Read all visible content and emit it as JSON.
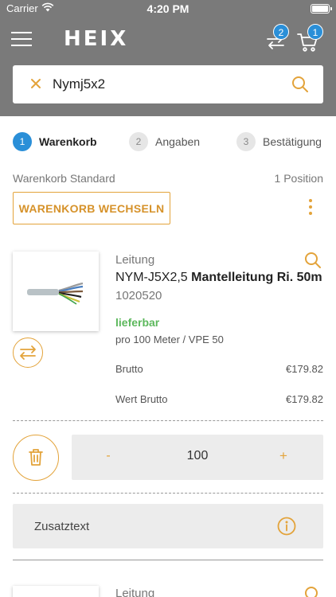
{
  "status_bar": {
    "carrier": "Carrier",
    "time": "4:20 PM"
  },
  "header": {
    "logo": "HEIX",
    "compare_badge": "2",
    "cart_badge": "1"
  },
  "search": {
    "value": "Nymj5x2"
  },
  "steps": [
    {
      "number": "1",
      "label": "Warenkorb",
      "active": true
    },
    {
      "number": "2",
      "label": "Angaben",
      "active": false
    },
    {
      "number": "3",
      "label": "Bestätigung",
      "active": false
    }
  ],
  "cart": {
    "title": "Warenkorb Standard",
    "position_count": "1 Position",
    "switch_button": "WARENKORB WECHSELN"
  },
  "product": {
    "category": "Leitung",
    "name_prefix": "NYM-J5X2,5 ",
    "name_bold": "Mantelleitung Ri. 50m",
    "sku": "1020520",
    "stock": "lieferbar",
    "unit": "pro 100 Meter  / VPE 50",
    "brutto_label": "Brutto",
    "brutto_value": "€179.82",
    "wert_label": "Wert Brutto",
    "wert_value": "€179.82",
    "quantity": "100",
    "minus": "-",
    "plus": "+"
  },
  "extra_text": {
    "label": "Zusatztext"
  },
  "next_product": {
    "category": "Leitung"
  },
  "colors": {
    "header_bg": "#7a7a7a",
    "accent": "#e3a33a",
    "badge": "#2a8fd8",
    "stock": "#5cb85c"
  }
}
